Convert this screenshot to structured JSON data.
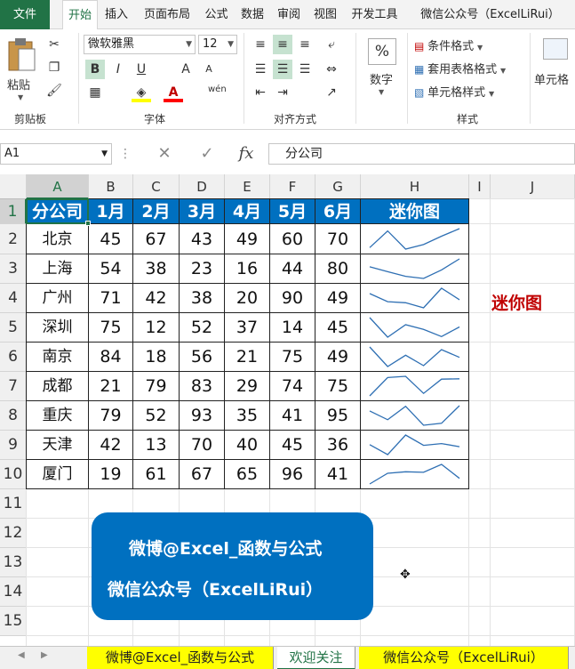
{
  "ribbon_tabs": [
    "文件",
    "开始",
    "插入",
    "页面布局",
    "公式",
    "数据",
    "审阅",
    "视图",
    "开发工具",
    "微信公众号（ExcelLiRui）"
  ],
  "active_tab": "开始",
  "clipboard": {
    "paste_label": "粘贴",
    "group_label": "剪贴板"
  },
  "font": {
    "name": "微软雅黑",
    "size": "12",
    "group_label": "字体",
    "bold": "B",
    "italic": "I",
    "underline": "U",
    "grow": "A",
    "shrink": "A",
    "phonetic": "wén"
  },
  "alignment": {
    "group_label": "对齐方式"
  },
  "number": {
    "label": "数字",
    "symbol": "%"
  },
  "styles": {
    "conditional": "条件格式",
    "table_format": "套用表格格式",
    "cell_styles": "单元格样式",
    "group_label": "样式"
  },
  "cells": {
    "label": "单元格"
  },
  "formula_bar": {
    "name_box": "A1",
    "fx_label": "fx",
    "content": "分公司"
  },
  "columns": [
    "A",
    "B",
    "C",
    "D",
    "E",
    "F",
    "G",
    "H",
    "I",
    "J"
  ],
  "rows": [
    "1",
    "2",
    "3",
    "4",
    "5",
    "6",
    "7",
    "8",
    "9",
    "10",
    "11",
    "12",
    "13",
    "14",
    "15"
  ],
  "table": {
    "headers": [
      "分公司",
      "1月",
      "2月",
      "3月",
      "4月",
      "5月",
      "6月",
      "迷你图"
    ],
    "data": [
      {
        "city": "北京",
        "values": [
          45,
          67,
          43,
          49,
          60,
          70
        ]
      },
      {
        "city": "上海",
        "values": [
          54,
          38,
          23,
          16,
          44,
          80
        ]
      },
      {
        "city": "广州",
        "values": [
          71,
          42,
          38,
          20,
          90,
          49
        ]
      },
      {
        "city": "深圳",
        "values": [
          75,
          12,
          52,
          37,
          14,
          45
        ]
      },
      {
        "city": "南京",
        "values": [
          84,
          18,
          56,
          21,
          75,
          49
        ]
      },
      {
        "city": "成都",
        "values": [
          21,
          79,
          83,
          29,
          74,
          75
        ]
      },
      {
        "city": "重庆",
        "values": [
          79,
          52,
          93,
          35,
          41,
          95
        ]
      },
      {
        "city": "天津",
        "values": [
          42,
          13,
          70,
          40,
          45,
          36
        ]
      },
      {
        "city": "厦门",
        "values": [
          19,
          61,
          67,
          65,
          96,
          41
        ]
      }
    ]
  },
  "sparkline_color": "#2e6fb3",
  "note": "迷你图",
  "banner": {
    "line1": "微博@Excel_函数与公式",
    "line2": "微信公众号（ExcelLiRui）"
  },
  "sheet_tabs": [
    "微博@Excel_函数与公式",
    "欢迎关注",
    "微信公众号（ExcelLiRui）"
  ],
  "active_sheet": "欢迎关注"
}
